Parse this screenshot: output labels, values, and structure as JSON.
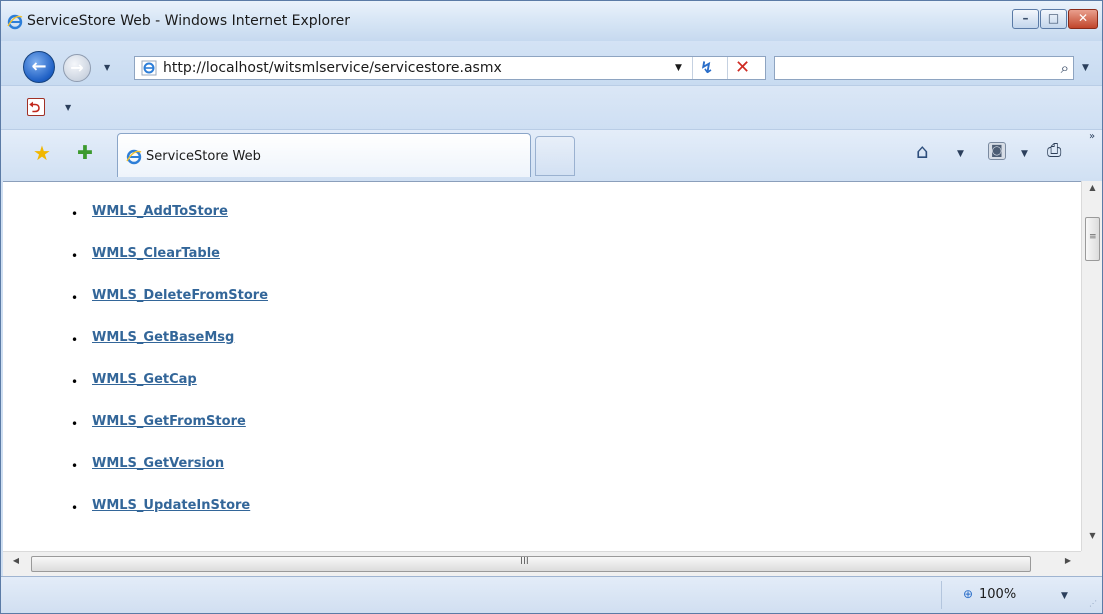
{
  "window": {
    "title": "ServiceStore Web - Windows Internet Explorer",
    "minimize_glyph": "–",
    "maximize_glyph": "□",
    "close_glyph": "✕"
  },
  "nav": {
    "back_glyph": "←",
    "forward_glyph": "→",
    "dropdown_glyph": "▼"
  },
  "address_bar": {
    "url": "http://localhost/witsmlservice/servicestore.asmx",
    "dropdown_glyph": "▼",
    "refresh_glyph": "↯",
    "stop_glyph": "✕"
  },
  "search": {
    "value": "",
    "search_glyph": "⌕",
    "dropdown_glyph": "▼"
  },
  "toolbar": {
    "pdf_glyph": "⮌",
    "dropdown_glyph": "▼"
  },
  "tabs": [
    {
      "title": "ServiceStore Web",
      "active": true
    }
  ],
  "favorites": {
    "star_glyph": "★",
    "add_glyph": "✚"
  },
  "command_bar": {
    "home_glyph": "⌂",
    "feed_glyph": "◙",
    "print_glyph": "⎙",
    "dropdown_glyph": "▼",
    "more_glyph": "»"
  },
  "content": {
    "bullet": "•",
    "operations": [
      "WMLS_AddToStore",
      "WMLS_ClearTable",
      "WMLS_DeleteFromStore",
      "WMLS_GetBaseMsg",
      "WMLS_GetCap",
      "WMLS_GetFromStore",
      "WMLS_GetVersion",
      "WMLS_UpdateInStore"
    ]
  },
  "scrollbars": {
    "up_glyph": "▲",
    "down_glyph": "▼",
    "left_glyph": "◀",
    "right_glyph": "▶",
    "grip_vertical": "≡",
    "grip_horizontal": "III"
  },
  "status_bar": {
    "zoom_glyph": "⊕",
    "zoom_level": "100%",
    "dropdown_glyph": "▼",
    "resize_grip": "⋰"
  },
  "colors": {
    "link": "#336699",
    "title_bar": "#dbe8f6",
    "close_button": "#c1452b"
  }
}
